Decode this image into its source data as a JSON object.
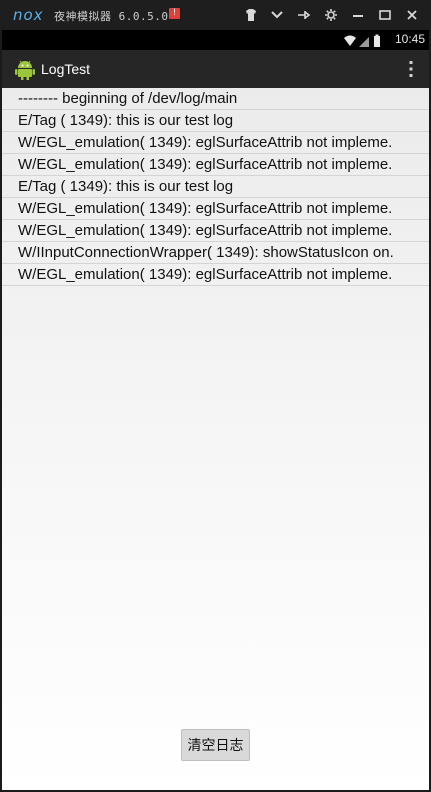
{
  "emulator": {
    "logo": "nox",
    "title": "夜神模拟器 6.0.5.0",
    "badge": "!"
  },
  "status_bar": {
    "time": "10:45"
  },
  "action_bar": {
    "title": "LogTest"
  },
  "log": {
    "lines": [
      "-------- beginning of /dev/log/main",
      "E/Tag     ( 1349): this is our test log",
      "W/EGL_emulation( 1349): eglSurfaceAttrib not impleme.",
      "W/EGL_emulation( 1349): eglSurfaceAttrib not impleme.",
      "E/Tag     ( 1349): this is our test log",
      "W/EGL_emulation( 1349): eglSurfaceAttrib not impleme.",
      "W/EGL_emulation( 1349): eglSurfaceAttrib not impleme.",
      "W/IInputConnectionWrapper( 1349): showStatusIcon on.",
      "W/EGL_emulation( 1349): eglSurfaceAttrib not impleme."
    ]
  },
  "clear_button": {
    "label": "清空日志"
  }
}
